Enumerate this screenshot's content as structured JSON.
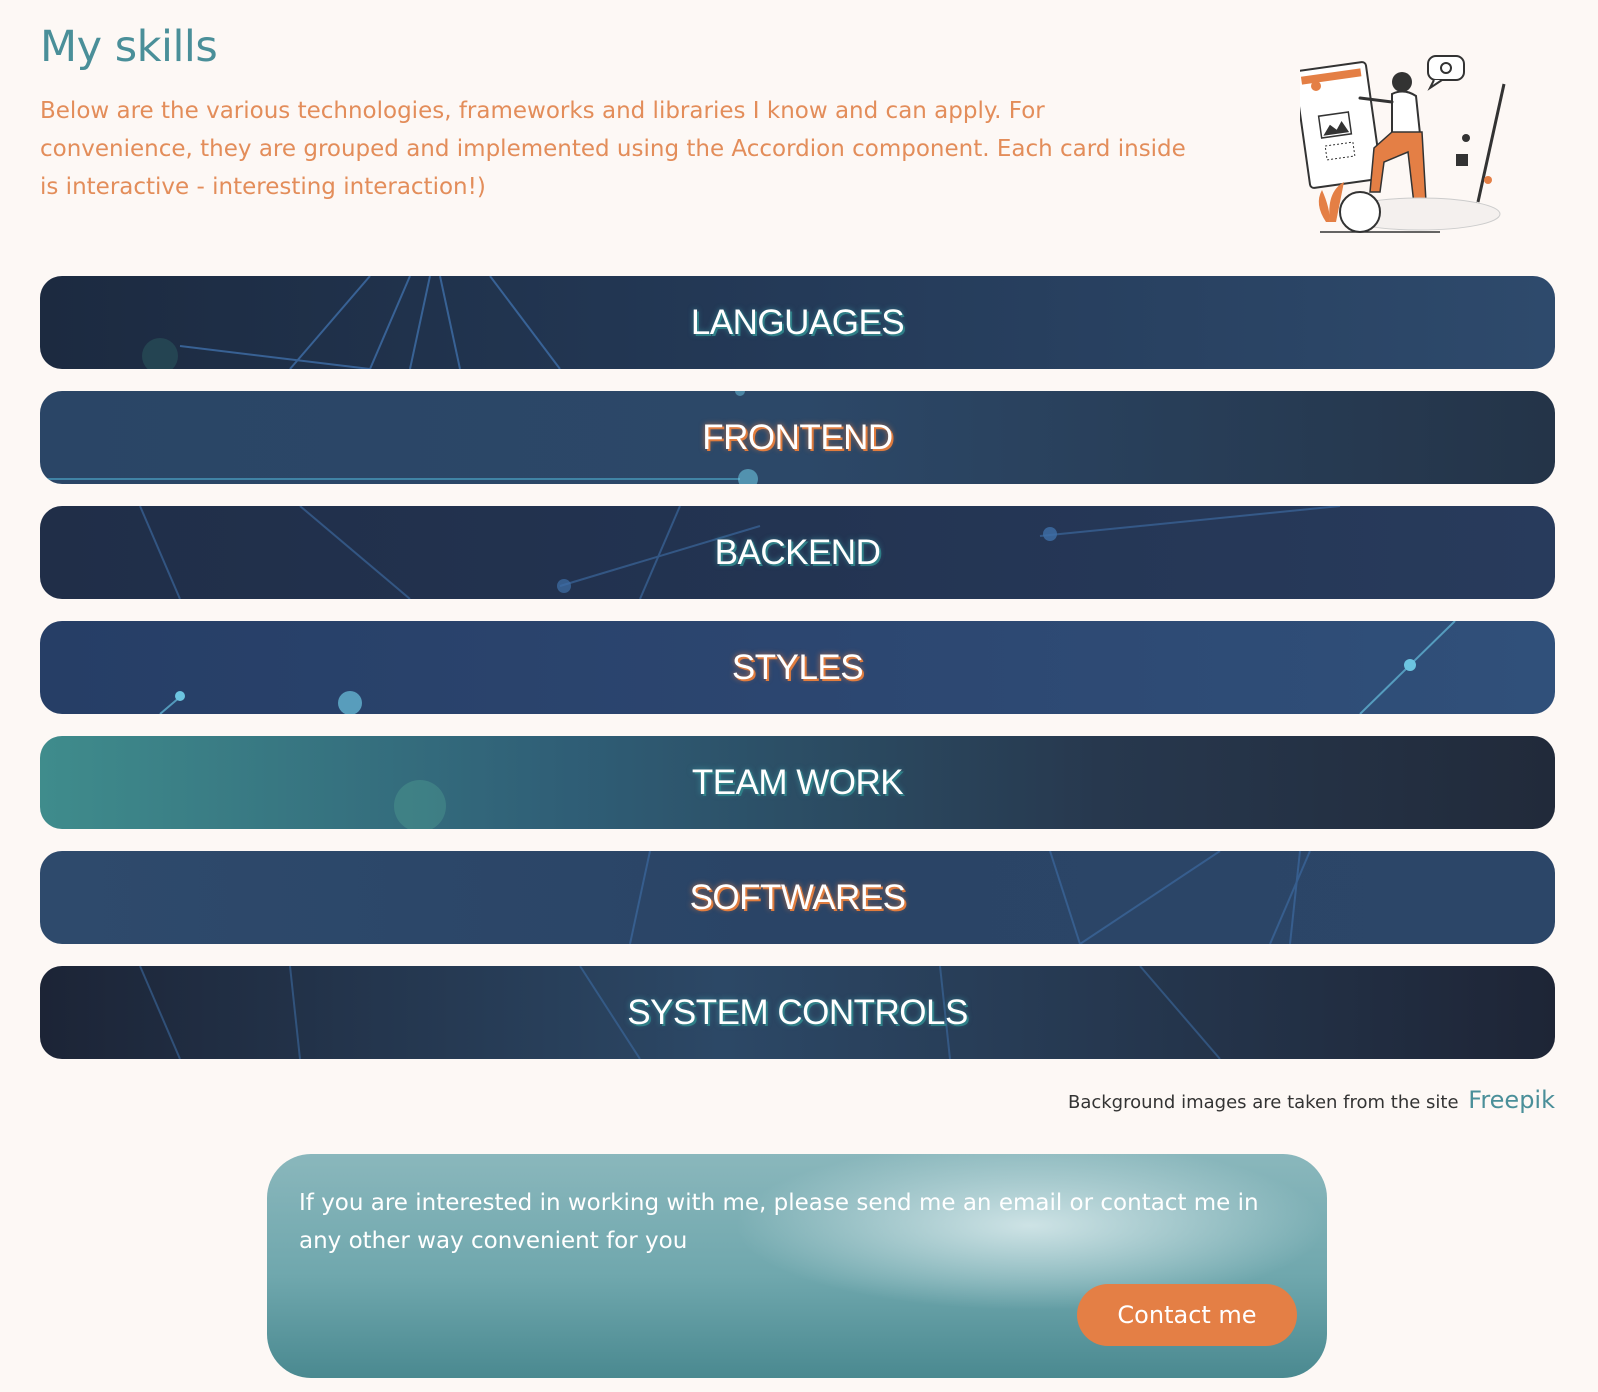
{
  "header": {
    "title": "My skills",
    "intro": "Below are the various technologies, frameworks and libraries I know and can apply. For convenience, they are grouped and implemented using the Accordion component. Each card inside is interactive - interesting interaction!)"
  },
  "accordion": {
    "items": [
      {
        "label": "LANGUAGES"
      },
      {
        "label": "FRONTEND"
      },
      {
        "label": "BACKEND"
      },
      {
        "label": "STYLES"
      },
      {
        "label": "TEAM WORK"
      },
      {
        "label": "SOFTWARES"
      },
      {
        "label": "SYSTEM CONTROLS"
      }
    ]
  },
  "credit": {
    "text": "Background images are taken from the site",
    "link": "Freepik"
  },
  "contact": {
    "text": "If you are interested in working with me, please send me an email or contact me in any other way convenient for you",
    "button_label": "Contact me"
  },
  "colors": {
    "title": "#4a8f99",
    "intro_text": "#e38d5a",
    "accent_orange": "#e47f45",
    "card_teal": "#6fa7ad",
    "page_background": "#fdf8f5"
  }
}
